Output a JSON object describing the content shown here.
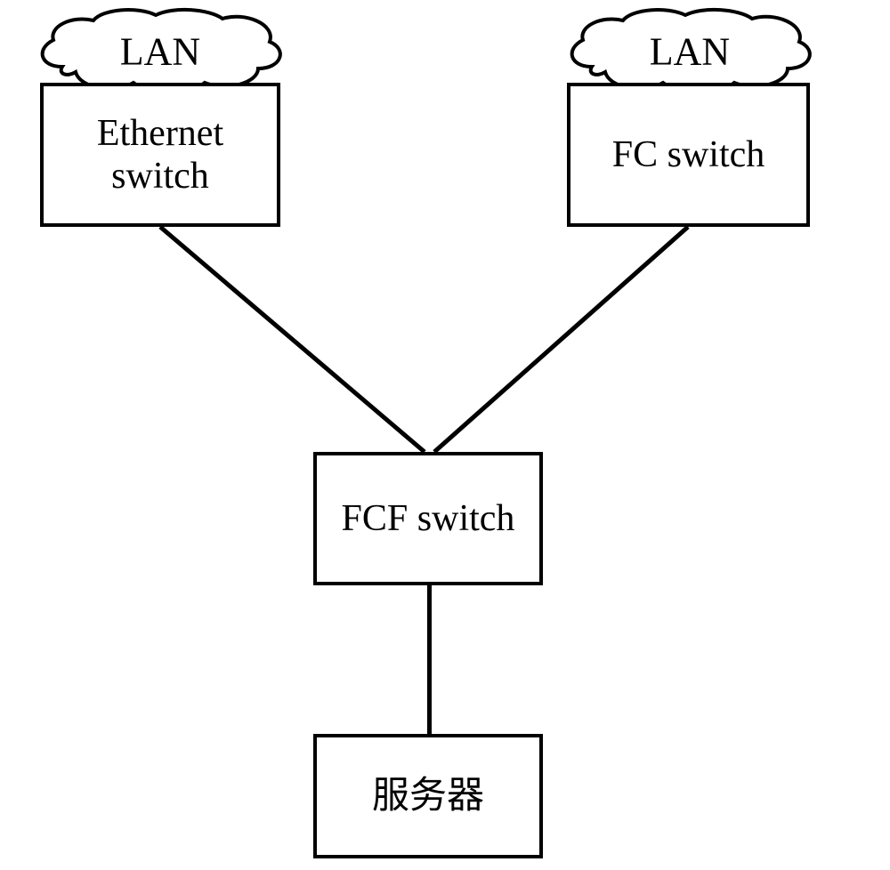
{
  "diagram": {
    "clouds": {
      "left": {
        "label": "LAN"
      },
      "right": {
        "label": "LAN"
      }
    },
    "boxes": {
      "ethernet_switch": {
        "label": "Ethernet\nswitch"
      },
      "fc_switch": {
        "label": "FC switch"
      },
      "fcf_switch": {
        "label": "FCF switch"
      },
      "server": {
        "label": "服务器"
      }
    }
  }
}
